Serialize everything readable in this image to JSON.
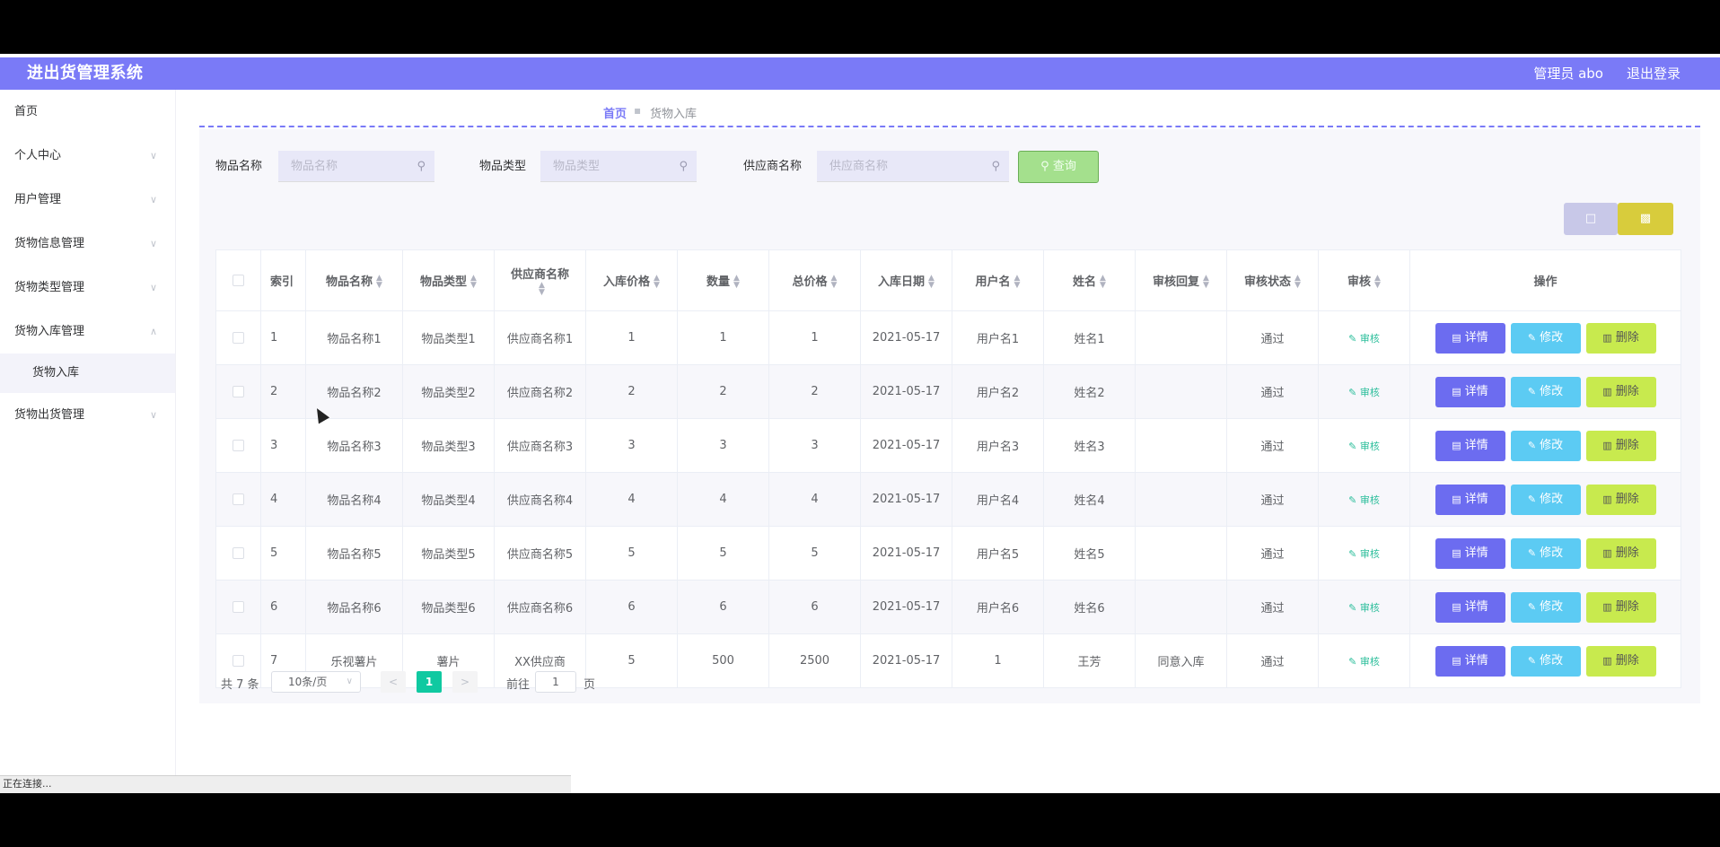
{
  "header": {
    "brand": "进出货管理系统",
    "user": "管理员 abo",
    "logout": "退出登录",
    "color": "#7a7af7"
  },
  "sidebar": {
    "items": [
      {
        "label": "首页",
        "has_arrow": false
      },
      {
        "label": "个人中心",
        "has_arrow": true
      },
      {
        "label": "用户管理",
        "has_arrow": true
      },
      {
        "label": "货物信息管理",
        "has_arrow": true
      },
      {
        "label": "货物类型管理",
        "has_arrow": true
      },
      {
        "label": "货物入库管理",
        "has_arrow": true,
        "expanded": true
      },
      {
        "label": "货物入库",
        "sub": true
      },
      {
        "label": "货物出货管理",
        "has_arrow": true
      }
    ]
  },
  "breadcrumb": {
    "home": "首页",
    "current": "货物入库"
  },
  "search": {
    "name_label": "物品名称",
    "name_placeholder": "物品名称",
    "type_label": "物品类型",
    "type_placeholder": "物品类型",
    "supplier_label": "供应商名称",
    "supplier_placeholder": "供应商名称",
    "query_button": "查询"
  },
  "table": {
    "headers": [
      "索引",
      "物品名称",
      "物品类型",
      "供应商名称",
      "入库价格",
      "数量",
      "总价格",
      "入库日期",
      "用户名",
      "姓名",
      "审核回复",
      "审核状态",
      "审核",
      "操作"
    ],
    "rows": [
      [
        "1",
        "物品名称1",
        "物品类型1",
        "供应商名称1",
        "1",
        "1",
        "1",
        "2021-05-17",
        "用户名1",
        "姓名1",
        "",
        "通过"
      ],
      [
        "2",
        "物品名称2",
        "物品类型2",
        "供应商名称2",
        "2",
        "2",
        "2",
        "2021-05-17",
        "用户名2",
        "姓名2",
        "",
        "通过"
      ],
      [
        "3",
        "物品名称3",
        "物品类型3",
        "供应商名称3",
        "3",
        "3",
        "3",
        "2021-05-17",
        "用户名3",
        "姓名3",
        "",
        "通过"
      ],
      [
        "4",
        "物品名称4",
        "物品类型4",
        "供应商名称4",
        "4",
        "4",
        "4",
        "2021-05-17",
        "用户名4",
        "姓名4",
        "",
        "通过"
      ],
      [
        "5",
        "物品名称5",
        "物品类型5",
        "供应商名称5",
        "5",
        "5",
        "5",
        "2021-05-17",
        "用户名5",
        "姓名5",
        "",
        "通过"
      ],
      [
        "6",
        "物品名称6",
        "物品类型6",
        "供应商名称6",
        "6",
        "6",
        "6",
        "2021-05-17",
        "用户名6",
        "姓名6",
        "",
        "通过"
      ],
      [
        "7",
        "乐视薯片",
        "薯片",
        "XX供应商",
        "5",
        "500",
        "2500",
        "2021-05-17",
        "1",
        "王芳",
        "同意入库",
        "通过"
      ]
    ],
    "audit_link": "审核",
    "actions": {
      "detail": "详情",
      "edit": "修改",
      "delete": "删除"
    }
  },
  "pagination": {
    "total": "共 7 条",
    "page_size": "10条/页",
    "current": "1",
    "goto_label": "前往",
    "goto_value": "1",
    "page_label": "页"
  },
  "status_bar": "正在连接..."
}
